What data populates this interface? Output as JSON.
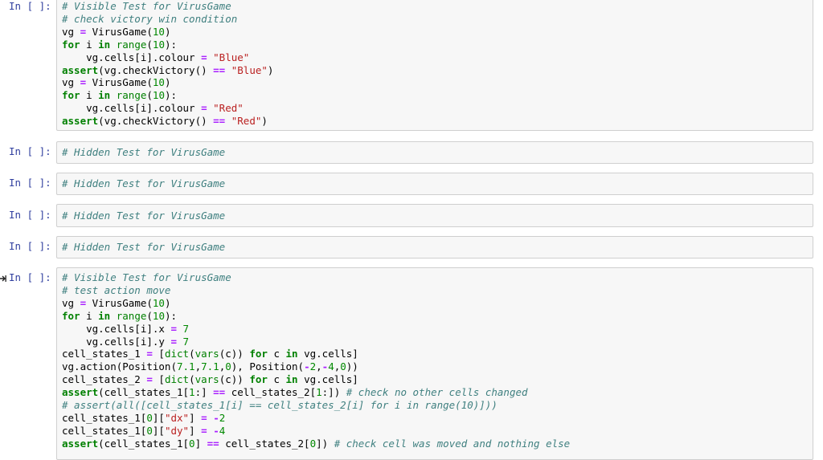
{
  "cells": [
    {
      "prompt": "In [ ]:",
      "lines": [
        [
          {
            "t": "# Visible Test for VirusGame",
            "c": "cm"
          }
        ],
        [
          {
            "t": "# check victory win condition",
            "c": "cm"
          }
        ],
        [
          {
            "t": "vg "
          },
          {
            "t": "=",
            "c": "op"
          },
          {
            "t": " VirusGame("
          },
          {
            "t": "10",
            "c": "nm"
          },
          {
            "t": ")"
          }
        ],
        [
          {
            "t": "for",
            "c": "kw"
          },
          {
            "t": " i "
          },
          {
            "t": "in",
            "c": "kw"
          },
          {
            "t": " "
          },
          {
            "t": "range",
            "c": "bi"
          },
          {
            "t": "("
          },
          {
            "t": "10",
            "c": "nm"
          },
          {
            "t": "):"
          }
        ],
        [
          {
            "t": "    vg.cells[i].colour "
          },
          {
            "t": "=",
            "c": "op"
          },
          {
            "t": " "
          },
          {
            "t": "\"Blue\"",
            "c": "st"
          }
        ],
        [
          {
            "t": "assert",
            "c": "kw"
          },
          {
            "t": "(vg.checkVictory() "
          },
          {
            "t": "==",
            "c": "op"
          },
          {
            "t": " "
          },
          {
            "t": "\"Blue\"",
            "c": "st"
          },
          {
            "t": ")"
          }
        ],
        [
          {
            "t": "vg "
          },
          {
            "t": "=",
            "c": "op"
          },
          {
            "t": " VirusGame("
          },
          {
            "t": "10",
            "c": "nm"
          },
          {
            "t": ")"
          }
        ],
        [
          {
            "t": "for",
            "c": "kw"
          },
          {
            "t": " i "
          },
          {
            "t": "in",
            "c": "kw"
          },
          {
            "t": " "
          },
          {
            "t": "range",
            "c": "bi"
          },
          {
            "t": "("
          },
          {
            "t": "10",
            "c": "nm"
          },
          {
            "t": "):"
          }
        ],
        [
          {
            "t": "    vg.cells[i].colour "
          },
          {
            "t": "=",
            "c": "op"
          },
          {
            "t": " "
          },
          {
            "t": "\"Red\"",
            "c": "st"
          }
        ],
        [
          {
            "t": "assert",
            "c": "kw"
          },
          {
            "t": "(vg.checkVictory() "
          },
          {
            "t": "==",
            "c": "op"
          },
          {
            "t": " "
          },
          {
            "t": "\"Red\"",
            "c": "st"
          },
          {
            "t": ")"
          }
        ]
      ]
    },
    {
      "prompt": "In [ ]:",
      "lines": [
        [
          {
            "t": "# Hidden Test for VirusGame",
            "c": "cm"
          }
        ]
      ]
    },
    {
      "prompt": "In [ ]:",
      "lines": [
        [
          {
            "t": "# Hidden Test for VirusGame",
            "c": "cm"
          }
        ]
      ]
    },
    {
      "prompt": "In [ ]:",
      "lines": [
        [
          {
            "t": "# Hidden Test for VirusGame",
            "c": "cm"
          }
        ]
      ]
    },
    {
      "prompt": "In [ ]:",
      "lines": [
        [
          {
            "t": "# Hidden Test for VirusGame",
            "c": "cm"
          }
        ]
      ]
    },
    {
      "prompt": "In [ ]:",
      "selected": true,
      "lines": [
        [
          {
            "t": "# Visible Test for VirusGame",
            "c": "cm"
          }
        ],
        [
          {
            "t": "# test action move",
            "c": "cm"
          }
        ],
        [
          {
            "t": "vg "
          },
          {
            "t": "=",
            "c": "op"
          },
          {
            "t": " VirusGame("
          },
          {
            "t": "10",
            "c": "nm"
          },
          {
            "t": ")"
          }
        ],
        [
          {
            "t": "for",
            "c": "kw"
          },
          {
            "t": " i "
          },
          {
            "t": "in",
            "c": "kw"
          },
          {
            "t": " "
          },
          {
            "t": "range",
            "c": "bi"
          },
          {
            "t": "("
          },
          {
            "t": "10",
            "c": "nm"
          },
          {
            "t": "):"
          }
        ],
        [
          {
            "t": "    vg.cells[i].x "
          },
          {
            "t": "=",
            "c": "op"
          },
          {
            "t": " "
          },
          {
            "t": "7",
            "c": "nm"
          }
        ],
        [
          {
            "t": "    vg.cells[i].y "
          },
          {
            "t": "=",
            "c": "op"
          },
          {
            "t": " "
          },
          {
            "t": "7",
            "c": "nm"
          }
        ],
        [
          {
            "t": "cell_states_1 "
          },
          {
            "t": "=",
            "c": "op"
          },
          {
            "t": " ["
          },
          {
            "t": "dict",
            "c": "bi"
          },
          {
            "t": "("
          },
          {
            "t": "vars",
            "c": "bi"
          },
          {
            "t": "(c)) "
          },
          {
            "t": "for",
            "c": "kw"
          },
          {
            "t": " c "
          },
          {
            "t": "in",
            "c": "kw"
          },
          {
            "t": " vg.cells]"
          }
        ],
        [
          {
            "t": "vg.action(Position("
          },
          {
            "t": "7.1",
            "c": "nm"
          },
          {
            "t": ","
          },
          {
            "t": "7.1",
            "c": "nm"
          },
          {
            "t": ","
          },
          {
            "t": "0",
            "c": "nm"
          },
          {
            "t": "), Position("
          },
          {
            "t": "-",
            "c": "op"
          },
          {
            "t": "2",
            "c": "nm"
          },
          {
            "t": ","
          },
          {
            "t": "-",
            "c": "op"
          },
          {
            "t": "4",
            "c": "nm"
          },
          {
            "t": ","
          },
          {
            "t": "0",
            "c": "nm"
          },
          {
            "t": "))"
          }
        ],
        [
          {
            "t": "cell_states_2 "
          },
          {
            "t": "=",
            "c": "op"
          },
          {
            "t": " ["
          },
          {
            "t": "dict",
            "c": "bi"
          },
          {
            "t": "("
          },
          {
            "t": "vars",
            "c": "bi"
          },
          {
            "t": "(c)) "
          },
          {
            "t": "for",
            "c": "kw"
          },
          {
            "t": " c "
          },
          {
            "t": "in",
            "c": "kw"
          },
          {
            "t": " vg.cells]"
          }
        ],
        [
          {
            "t": "assert",
            "c": "kw"
          },
          {
            "t": "(cell_states_1["
          },
          {
            "t": "1",
            "c": "nm"
          },
          {
            "t": ":] "
          },
          {
            "t": "==",
            "c": "op"
          },
          {
            "t": " cell_states_2["
          },
          {
            "t": "1",
            "c": "nm"
          },
          {
            "t": ":]) "
          },
          {
            "t": "# check no other cells changed",
            "c": "cm"
          }
        ],
        [
          {
            "t": "# assert(all([cell_states_1[i] == cell_states_2[i] for i in range(10)]))",
            "c": "cm"
          }
        ],
        [
          {
            "t": "cell_states_1["
          },
          {
            "t": "0",
            "c": "nm"
          },
          {
            "t": "]["
          },
          {
            "t": "\"dx\"",
            "c": "st"
          },
          {
            "t": "] "
          },
          {
            "t": "=",
            "c": "op"
          },
          {
            "t": " "
          },
          {
            "t": "-",
            "c": "op"
          },
          {
            "t": "2",
            "c": "nm"
          }
        ],
        [
          {
            "t": "cell_states_1["
          },
          {
            "t": "0",
            "c": "nm"
          },
          {
            "t": "]["
          },
          {
            "t": "\"dy\"",
            "c": "st"
          },
          {
            "t": "] "
          },
          {
            "t": "=",
            "c": "op"
          },
          {
            "t": " "
          },
          {
            "t": "-",
            "c": "op"
          },
          {
            "t": "4",
            "c": "nm"
          }
        ],
        [
          {
            "t": "assert",
            "c": "kw"
          },
          {
            "t": "(cell_states_1["
          },
          {
            "t": "0",
            "c": "nm"
          },
          {
            "t": "] "
          },
          {
            "t": "==",
            "c": "op"
          },
          {
            "t": " cell_states_2["
          },
          {
            "t": "0",
            "c": "nm"
          },
          {
            "t": "]) "
          },
          {
            "t": "# check cell was moved and nothing else",
            "c": "cm"
          }
        ]
      ]
    }
  ]
}
